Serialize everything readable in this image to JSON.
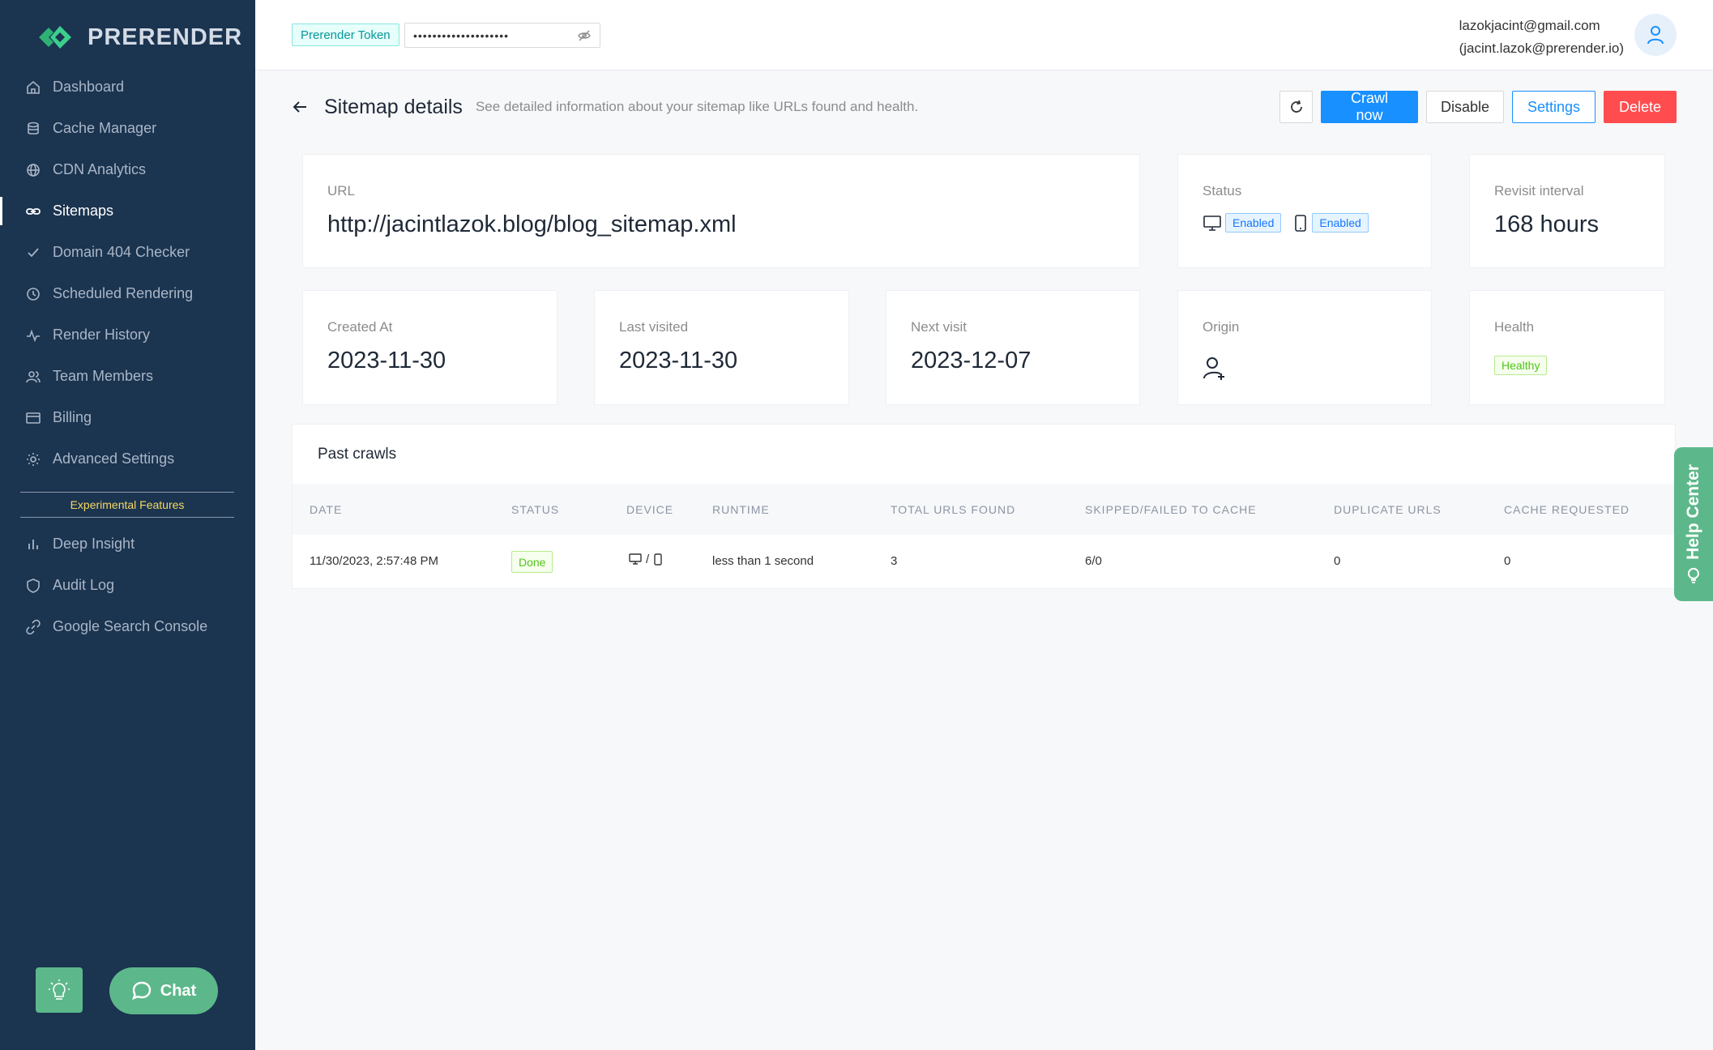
{
  "app": {
    "logo_text": "PRERENDER",
    "brand_color": "#5cb88a",
    "sidebar_color": "#1b3450"
  },
  "sidebar": {
    "items": [
      {
        "label": "Dashboard",
        "icon": "home-icon"
      },
      {
        "label": "Cache Manager",
        "icon": "database-icon"
      },
      {
        "label": "CDN Analytics",
        "icon": "globe-icon"
      },
      {
        "label": "Sitemaps",
        "icon": "link-icon",
        "active": true
      },
      {
        "label": "Domain 404 Checker",
        "icon": "check-icon"
      },
      {
        "label": "Scheduled Rendering",
        "icon": "clock-icon"
      },
      {
        "label": "Render History",
        "icon": "activity-icon"
      },
      {
        "label": "Team Members",
        "icon": "users-icon"
      },
      {
        "label": "Billing",
        "icon": "credit-card-icon"
      },
      {
        "label": "Advanced Settings",
        "icon": "gear-icon"
      }
    ],
    "experimental_label": "Experimental Features",
    "experimental_items": [
      {
        "label": "Deep Insight",
        "icon": "bar-chart-icon"
      },
      {
        "label": "Audit Log",
        "icon": "shield-icon"
      },
      {
        "label": "Google Search Console",
        "icon": "link-icon"
      }
    ],
    "chat_label": "Chat"
  },
  "header": {
    "token_label": "Prerender Token",
    "token_value": "••••••••••••••••••••",
    "user_email": "lazokjacint@gmail.com",
    "user_sub": "(jacint.lazok@prerender.io)"
  },
  "page": {
    "title": "Sitemap details",
    "subtitle": "See detailed information about your sitemap like URLs found and health.",
    "actions": {
      "crawl_now": "Crawl now",
      "disable": "Disable",
      "settings": "Settings",
      "delete": "Delete"
    }
  },
  "details": {
    "url_label": "URL",
    "url_value": "http://jacintlazok.blog/blog_sitemap.xml",
    "status_label": "Status",
    "status_desktop": "Enabled",
    "status_mobile": "Enabled",
    "revisit_label": "Revisit interval",
    "revisit_value": "168 hours",
    "created_label": "Created At",
    "created_value": "2023-11-30",
    "last_visited_label": "Last visited",
    "last_visited_value": "2023-11-30",
    "next_visit_label": "Next visit",
    "next_visit_value": "2023-12-07",
    "origin_label": "Origin",
    "health_label": "Health",
    "health_value": "Healthy"
  },
  "crawls": {
    "title": "Past crawls",
    "columns": [
      "DATE",
      "STATUS",
      "DEVICE",
      "RUNTIME",
      "TOTAL URLS FOUND",
      "SKIPPED/FAILED TO CACHE",
      "DUPLICATE URLS",
      "CACHE REQUESTED"
    ],
    "rows": [
      {
        "date": "11/30/2023, 2:57:48 PM",
        "status": "Done",
        "device_sep": "/",
        "runtime": "less than 1 second",
        "total_urls": "3",
        "skipped_failed": "6/0",
        "duplicate": "0",
        "cache_requested": "0"
      }
    ]
  },
  "help_center": {
    "label": "Help Center"
  }
}
